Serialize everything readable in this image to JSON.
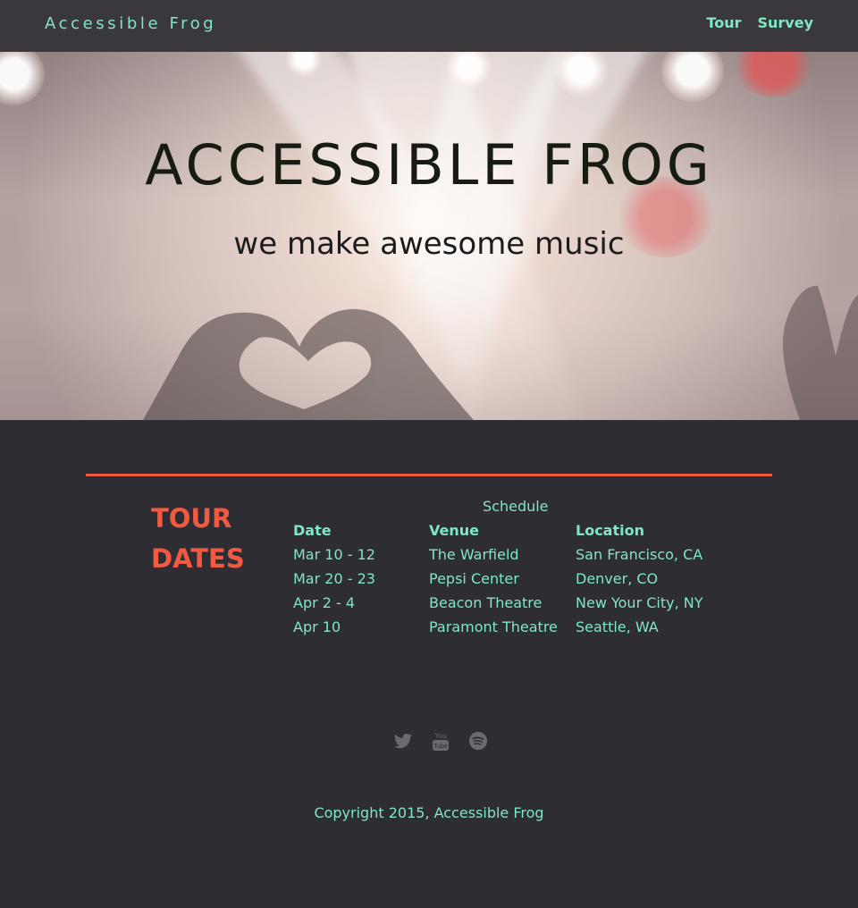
{
  "nav": {
    "brand": "Accessible Frog",
    "links": [
      "Tour",
      "Survey"
    ]
  },
  "hero": {
    "title": "ACCESSIBLE FROG",
    "subtitle": "we make awesome music"
  },
  "tour": {
    "heading_line1": "TOUR",
    "heading_line2": "DATES",
    "caption": "Schedule",
    "columns": [
      "Date",
      "Venue",
      "Location"
    ],
    "rows": [
      [
        "Mar 10 - 12",
        "The Warfield",
        "San Francisco, CA"
      ],
      [
        "Mar 20 - 23",
        "Pepsi Center",
        "Denver, CO"
      ],
      [
        "Apr 2 - 4",
        "Beacon Theatre",
        "New Your City, NY"
      ],
      [
        "Apr 10",
        "Paramont Theatre",
        "Seattle, WA"
      ]
    ]
  },
  "social": {
    "icons": [
      "twitter-icon",
      "youtube-icon",
      "spotify-icon"
    ],
    "youtube_text_top": "You",
    "youtube_text_bottom": "Tube"
  },
  "footer": {
    "copyright": "Copyright 2015, Accessible Frog"
  },
  "colors": {
    "accent": "#7fe6c6",
    "highlight": "#f05a41",
    "background": "#2e2d33",
    "navbar": "#3a383d"
  }
}
